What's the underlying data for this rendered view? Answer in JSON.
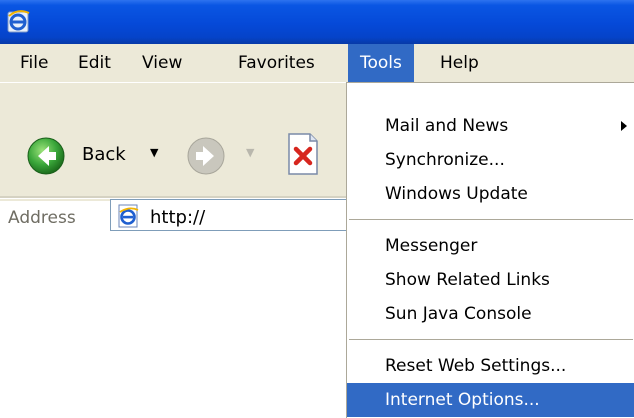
{
  "menubar": {
    "items": [
      {
        "label": "File"
      },
      {
        "label": "Edit"
      },
      {
        "label": "View"
      },
      {
        "label": "Favorites"
      },
      {
        "label": "Tools",
        "active": true
      },
      {
        "label": "Help"
      }
    ]
  },
  "toolbar": {
    "back_label": "Back"
  },
  "address": {
    "label": "Address",
    "value": "http://"
  },
  "tools_menu": {
    "items": [
      {
        "label": "Mail and News",
        "has_submenu": true
      },
      {
        "label": "Synchronize..."
      },
      {
        "label": "Windows Update"
      },
      {
        "label": "Messenger"
      },
      {
        "label": "Show Related Links"
      },
      {
        "label": "Sun Java Console"
      },
      {
        "label": "Reset Web Settings..."
      },
      {
        "label": "Internet Options...",
        "highlighted": true
      }
    ]
  },
  "colors": {
    "titlebar": "#0549d8",
    "menu_bg": "#ece9d8",
    "highlight": "#316ac5",
    "back_green": "#2e9b2e"
  },
  "icons": {
    "app": "ie-logo-icon",
    "back": "back-arrow-icon",
    "forward": "forward-arrow-icon",
    "stop": "stop-icon",
    "address": "ie-page-icon",
    "submenu": "submenu-arrow-icon"
  }
}
